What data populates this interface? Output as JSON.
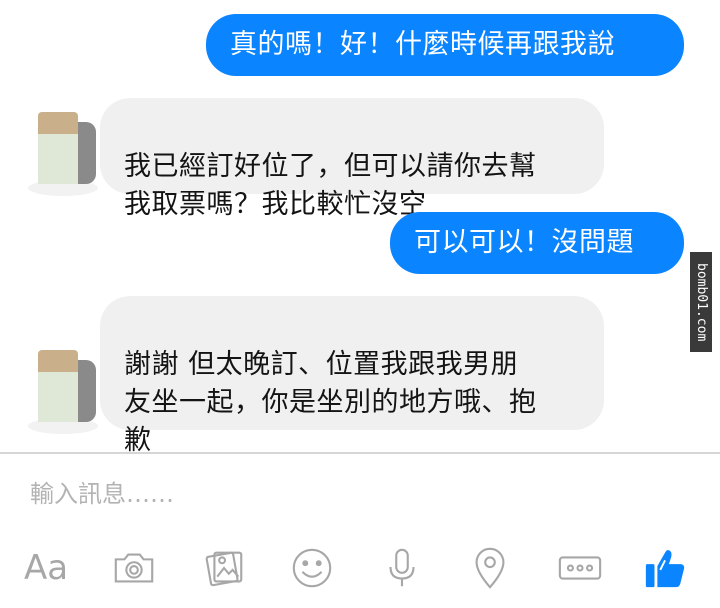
{
  "messages": [
    {
      "direction": "out",
      "text": "真的嗎！好！什麼時候再跟我說"
    },
    {
      "direction": "in",
      "text": "我已經訂好位了，但可以請你去幫\n我取票嗎？我比較忙沒空"
    },
    {
      "direction": "out",
      "text": "可以可以！沒問題"
    },
    {
      "direction": "in",
      "text": "謝謝 但太晚訂、位置我跟我男朋\n友坐一起，你是坐別的地方哦、抱\n歉"
    }
  ],
  "watermark": "bomb01.com",
  "composer": {
    "placeholder": "輸入訊息……"
  },
  "toolbar": {
    "text_format_label": "Aa",
    "icons": [
      "text-format-icon",
      "camera-icon",
      "gallery-icon",
      "emoji-icon",
      "microphone-icon",
      "location-icon",
      "more-icon",
      "thumbs-up-icon"
    ]
  },
  "colors": {
    "outgoing": "#0b84ff",
    "incoming": "#f1f0f0",
    "toolbar_icon": "#a7a7a7",
    "like": "#0b84ff"
  }
}
